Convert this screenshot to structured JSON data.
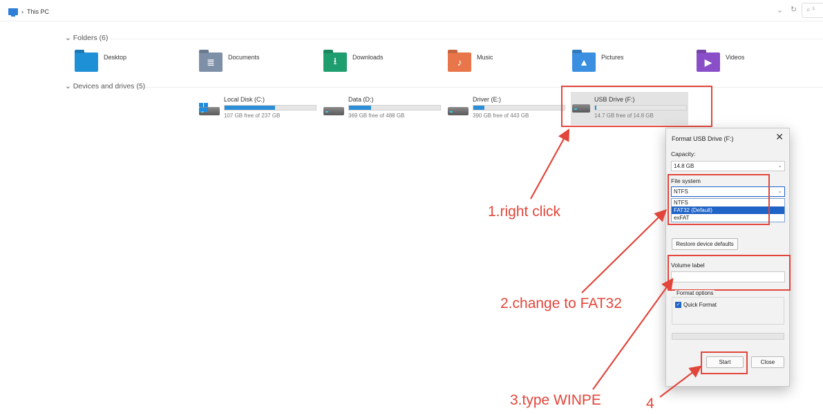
{
  "breadcrumb": {
    "location": "This PC",
    "separator": "›"
  },
  "toolbar": {
    "dropdown_icon": "chevron-down-icon",
    "dropdown_glyph": "⌄",
    "refresh_glyph": "↻",
    "search_glyph": "⌕ ¹"
  },
  "folders_section": {
    "label": "Folders (6)",
    "items": [
      {
        "label": "Desktop",
        "icon": "desktop-folder-icon",
        "color": "#1e90d6",
        "glyph": ""
      },
      {
        "label": "Documents",
        "icon": "documents-folder-icon",
        "color": "#7e8fa8",
        "glyph": "≣"
      },
      {
        "label": "Downloads",
        "icon": "downloads-folder-icon",
        "color": "#1e9e6e",
        "glyph": "⭳"
      },
      {
        "label": "Music",
        "icon": "music-folder-icon",
        "color": "#e8764a",
        "glyph": "♪"
      },
      {
        "label": "Pictures",
        "icon": "pictures-folder-icon",
        "color": "#3a8fe0",
        "glyph": "▲"
      },
      {
        "label": "Videos",
        "icon": "videos-folder-icon",
        "color": "#8a4fc8",
        "glyph": "▶"
      }
    ]
  },
  "drives_section": {
    "label": "Devices and drives (5)",
    "items": [
      {
        "name": "Local Disk (C:)",
        "free": "107 GB free of 237 GB",
        "used_fraction": 0.55
      },
      {
        "name": "Data (D:)",
        "free": "369 GB free of 488 GB",
        "used_fraction": 0.24
      },
      {
        "name": "Driver (E:)",
        "free": "390 GB free of 443 GB",
        "used_fraction": 0.12
      },
      {
        "name": "USB Drive (F:)",
        "free": "14.7 GB free of 14.8 GB",
        "used_fraction": 0.01
      }
    ]
  },
  "dialog": {
    "title": "Format USB Drive (F:)",
    "close_glyph": "✕",
    "capacity_label": "Capacity:",
    "capacity_value": "14.8 GB",
    "filesystem_label": "File system",
    "filesystem_value": "NTFS",
    "filesystem_options": [
      "NTFS",
      "FAT32 (Default)",
      "exFAT"
    ],
    "filesystem_selected_option": "FAT32 (Default)",
    "restore_button": "Restore device defaults",
    "volume_label": "Volume label",
    "volume_value": "",
    "format_options_label": "Format options",
    "quick_format_label": "Quick Format",
    "quick_format_checked": true,
    "start_button": "Start",
    "close_button": "Close"
  },
  "annotations": [
    "1.right click",
    "2.change to FAT32",
    "3.type WINPE",
    "4"
  ],
  "colors": {
    "annotation": "#e2453a",
    "accent": "#1f63c6",
    "progress": "#2b8ed6"
  }
}
